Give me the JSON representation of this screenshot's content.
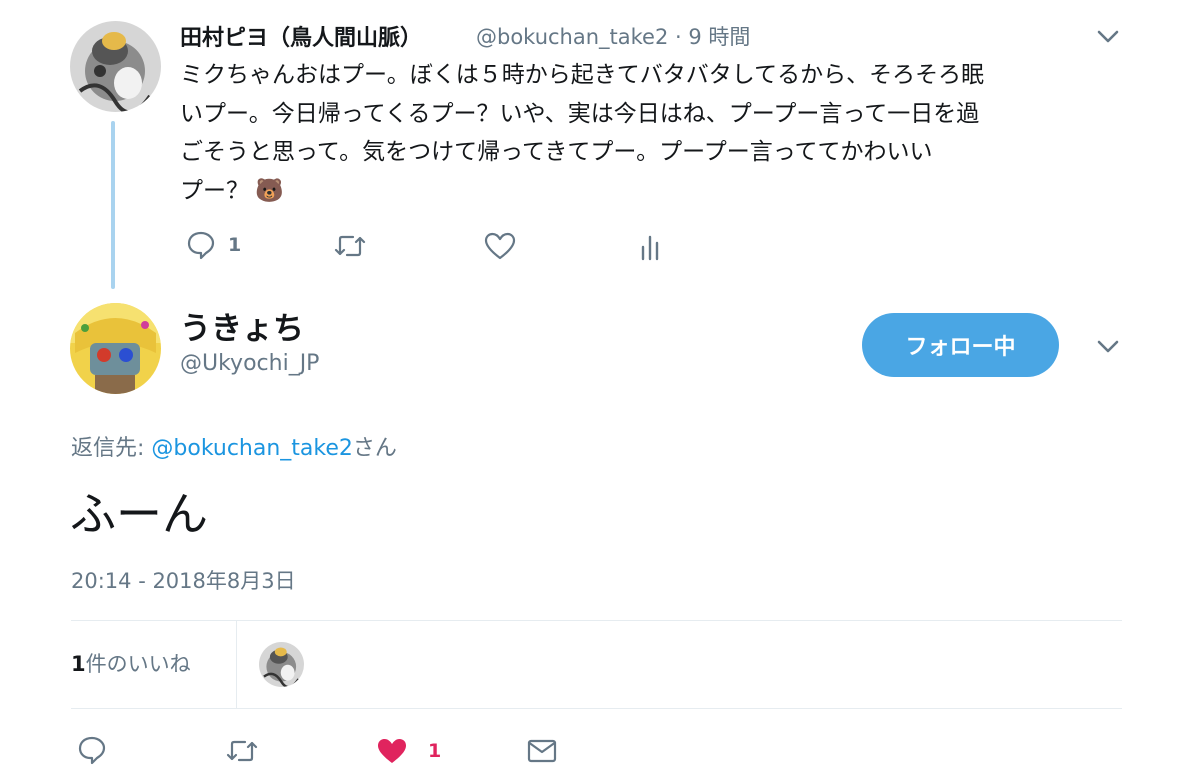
{
  "parent_tweet": {
    "display_name": "田村ピヨ（鳥人間山脈）",
    "handle_time": "@bokuchan_take2 · 9 時間",
    "text_lines": [
      "ミクちゃんおはプー。ぼくは５時から起きてバタバタしてるから、そろそろ眠",
      "いプー。今日帰ってくるプー？いや、実は今日はね、プープー言って一日を過",
      "ごそうと思って。気をつけて帰ってきてプー。プープー言っててかわいい",
      "プー？"
    ],
    "emoji": "🐻",
    "reply_count": "1",
    "icons": [
      "reply-icon",
      "retweet-icon",
      "like-icon",
      "analytics-icon",
      "chevron-down-icon"
    ]
  },
  "main_tweet": {
    "display_name": "うきょち",
    "handle": "@Ukyochi_JP",
    "follow_label": "フォロー中",
    "reply_prefix": "返信先: ",
    "reply_to": "@bokuchan_take2",
    "reply_suffix": "さん",
    "text": "ふーん",
    "timestamp": "20:14 - 2018年8月3日",
    "like_stats_count": "1",
    "like_stats_label": "件のいいね",
    "like_count": "1",
    "colors": {
      "like": "#e0245e",
      "accent": "#4aa6e4",
      "muted": "#657786",
      "link": "#1b95e0"
    }
  }
}
